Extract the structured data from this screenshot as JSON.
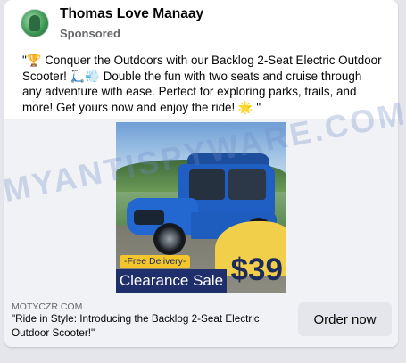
{
  "header": {
    "page_name": "Thomas Love Manaay",
    "sponsored_label": "Sponsored"
  },
  "post": {
    "trophy_emoji": "🏆",
    "line1": "Conquer the Outdoors with our Backlog 2-Seat Electric Outdoor Scooter!",
    "scooter_emoji": "🛴💨",
    "line2": "Double the fun with two seats and cruise through any adventure with ease. Perfect for exploring parks, trails, and more! Get yours now and enjoy the ride!",
    "star_emoji": "🌟",
    "open_quote": "\"",
    "close_quote": " \""
  },
  "ad_image": {
    "free_delivery": "-Free Delivery-",
    "clearance_sale": "Clearance Sale",
    "price": "$39"
  },
  "watermark": "MYANTISPYWARE.COM",
  "link_preview": {
    "domain": "MOTYCZR.COM",
    "headline": "\"Ride in Style: Introducing the Backlog 2-Seat Electric Outdoor Scooter!\"",
    "cta_label": "Order now"
  },
  "colors": {
    "background": "#e4e6eb",
    "card": "#ffffff",
    "secondary_text": "#65676b",
    "promo_yellow": "#f3c62e",
    "promo_navy": "#1f2f6b",
    "car_blue": "#1f5fc4"
  }
}
